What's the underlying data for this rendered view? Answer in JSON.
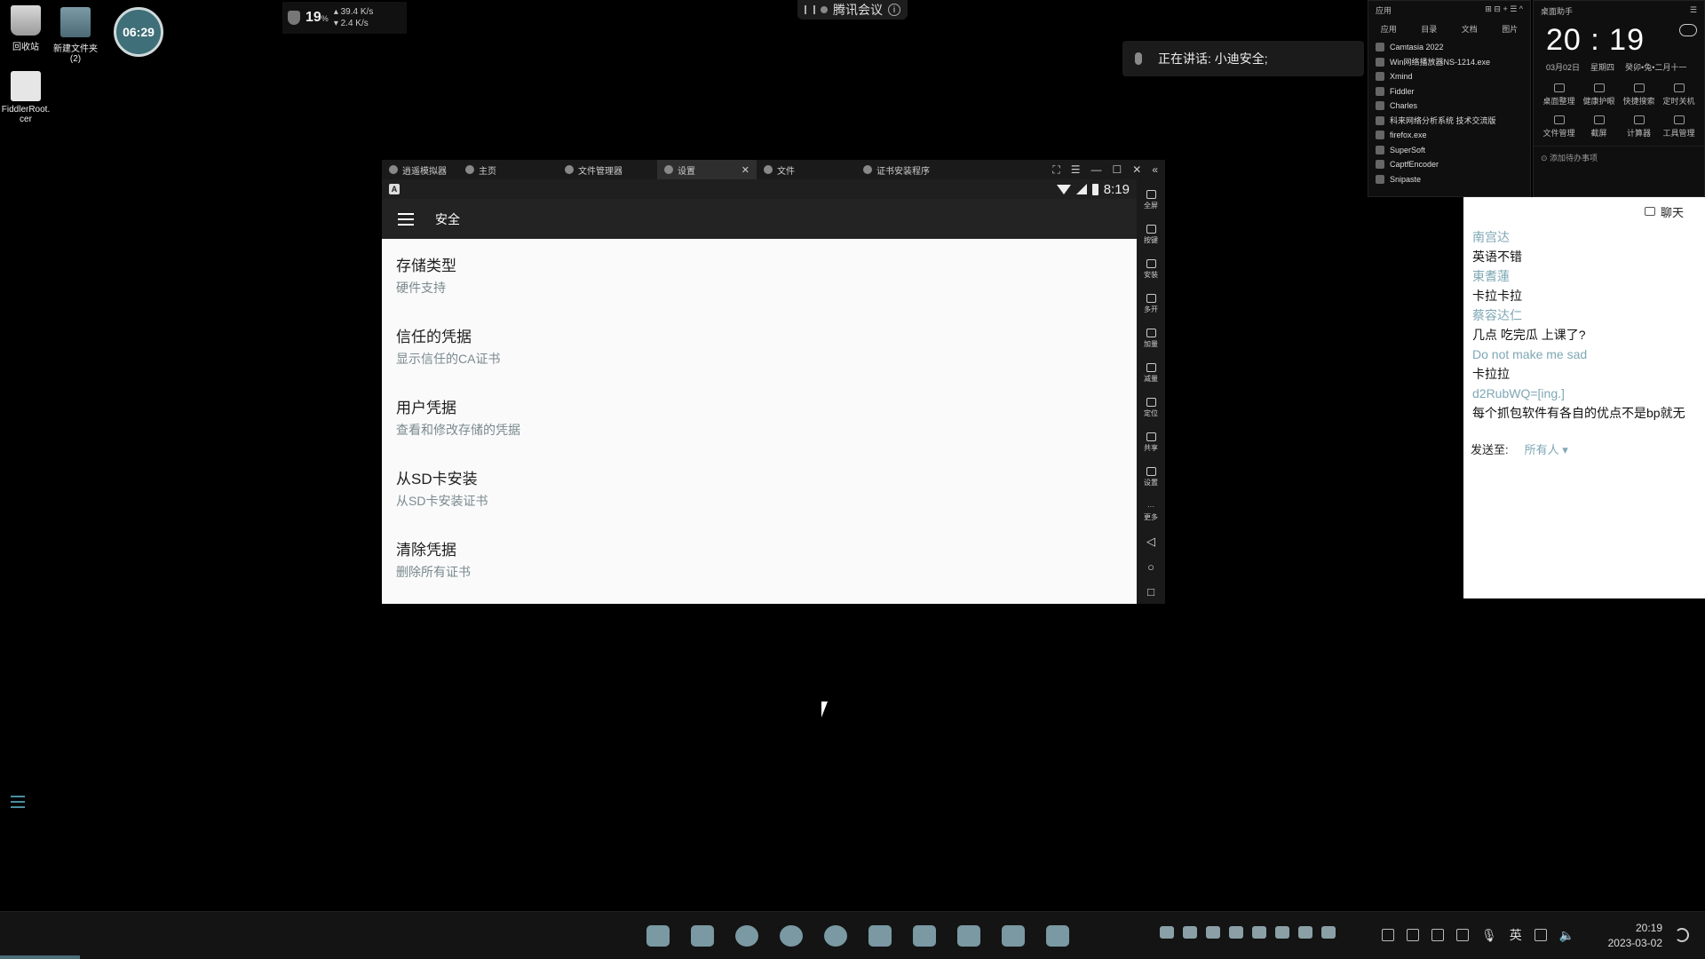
{
  "desktop": {
    "icons": [
      {
        "label": "回收站"
      },
      {
        "label": "新建文件夹\n(2)"
      },
      {
        "label": "FiddlerRoot.\ncer"
      }
    ],
    "timer_badge": "06:29"
  },
  "net_widget": {
    "cpu_pct": "19",
    "pct_unit": "%",
    "up_rate": "39.4 K/s",
    "down_rate": "2.4 K/s"
  },
  "meeting": {
    "app": "腾讯会议",
    "info": "i",
    "speaking": "正在讲话: 小迪安全;"
  },
  "launcher": {
    "title": "应用",
    "tabs": [
      "应用",
      "目录",
      "文档",
      "图片"
    ],
    "apps": [
      "Camtasia 2022",
      "Win网络播放器NS-1214.exe",
      "Xmind",
      "Fiddler",
      "Charles",
      "科来网络分析系统 技术交流版",
      "firefox.exe",
      "SuperSoft",
      "CaptfEncoder",
      "Snipaste"
    ]
  },
  "clock_widget": {
    "title": "桌面助手",
    "time": "20 : 19",
    "date": "03月02日",
    "weekday": "星期四",
    "lunar": "癸卯•兔•二月十一",
    "tools": [
      "桌面整理",
      "健康护眼",
      "快捷搜索",
      "定时关机",
      "文件管理",
      "截屏",
      "计算器",
      "工具管理"
    ],
    "todo": "添加待办事项"
  },
  "emulator": {
    "tabs": [
      {
        "label": "逍遥模拟器"
      },
      {
        "label": "主页"
      },
      {
        "label": "文件管理器"
      },
      {
        "label": "设置",
        "close": "✕"
      },
      {
        "label": "文件"
      },
      {
        "label": "证书安装程序"
      }
    ],
    "window_controls": [
      "⛶",
      "☰",
      "—",
      "☐",
      "✕",
      "«"
    ],
    "status": {
      "a_icon": "A",
      "time": "8:19"
    },
    "app_bar_title": "安全",
    "settings": [
      {
        "title": "存储类型",
        "subtitle": "硬件支持"
      },
      {
        "title": "信任的凭据",
        "subtitle": "显示信任的CA证书"
      },
      {
        "title": "用户凭据",
        "subtitle": "查看和修改存储的凭据"
      },
      {
        "title": "从SD卡安装",
        "subtitle": "从SD卡安装证书"
      },
      {
        "title": "清除凭据",
        "subtitle": "删除所有证书"
      }
    ],
    "sidebar": [
      {
        "label": "全屏",
        "icon": "fullscreen-icon"
      },
      {
        "label": "按键",
        "icon": "keyboard-icon"
      },
      {
        "label": "安装",
        "icon": "apk-icon"
      },
      {
        "label": "多开",
        "icon": "multi-instance-icon"
      },
      {
        "label": "加量",
        "icon": "volume-up-icon"
      },
      {
        "label": "减量",
        "icon": "volume-down-icon"
      },
      {
        "label": "定位",
        "icon": "location-icon"
      },
      {
        "label": "共享",
        "icon": "share-folder-icon"
      },
      {
        "label": "设置",
        "icon": "gear-icon"
      },
      {
        "label": "更多",
        "icon": "more-icon"
      }
    ],
    "nav": [
      "◁",
      "○",
      "□"
    ]
  },
  "chat": {
    "title": "聊天",
    "messages": [
      {
        "name": "南宫达",
        "text": "英语不错"
      },
      {
        "name": "東耆蓮",
        "text": "卡拉卡拉"
      },
      {
        "name": "蔡容达仁",
        "text": "几点 吃完瓜 上课了?"
      },
      {
        "name": "Do not make me sad",
        "text": "卡拉拉"
      },
      {
        "name": "d2RubWQ=[ing.]",
        "text": "每个抓包软件有各自的优点不是bp就无"
      }
    ],
    "send_label": "发送至:",
    "send_target": "所有人 ▾"
  },
  "taskbar": {
    "ime": "英",
    "time": "20:19",
    "date": "2023-03-02"
  },
  "colors": {
    "accent": "#7ea7b5",
    "android_bar": "#232323",
    "taskbar": "#141414"
  }
}
